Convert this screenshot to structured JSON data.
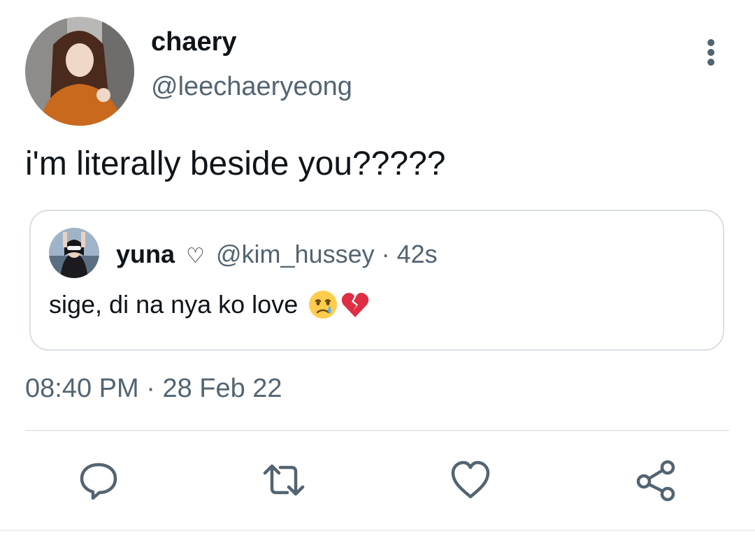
{
  "tweet": {
    "author": {
      "display_name": "chaery",
      "handle": "@leechaeryeong"
    },
    "text": "i'm literally beside you?????",
    "quoted": {
      "display_name": "yuna",
      "name_emoji": "♡",
      "handle": "@kim_hussey",
      "separator": "·",
      "age": "42s",
      "text": "sige, di na nya ko love",
      "emojis": [
        "crying-face",
        "broken-heart"
      ]
    },
    "time": "08:40 PM",
    "separator": "·",
    "date": "28 Feb 22"
  },
  "actions": [
    "reply",
    "retweet",
    "like",
    "share"
  ],
  "colors": {
    "text_primary": "#0f1419",
    "text_secondary": "#536471",
    "border": "#d9dee2"
  }
}
